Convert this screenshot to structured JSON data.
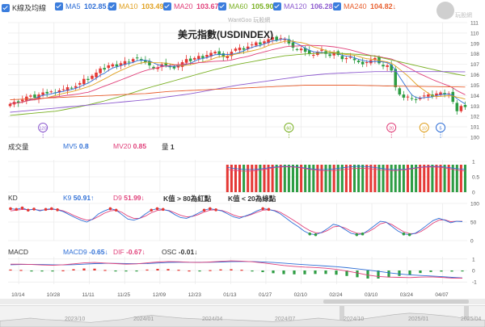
{
  "legend": {
    "items": [
      {
        "key": "k",
        "label": "K線及均線",
        "value": "",
        "color": "#333333"
      },
      {
        "key": "ma5",
        "label": "MA5",
        "value": "102.85↓",
        "color": "#2f6fd6"
      },
      {
        "key": "ma10",
        "label": "MA10",
        "value": "103.49↓",
        "color": "#e0a020"
      },
      {
        "key": "ma20",
        "label": "MA20",
        "value": "103.67↓",
        "color": "#e0407a"
      },
      {
        "key": "ma60",
        "label": "MA60",
        "value": "105.90↓",
        "color": "#7ab024"
      },
      {
        "key": "ma120",
        "label": "MA120",
        "value": "106.28↓",
        "color": "#8e5ccf"
      },
      {
        "key": "ma240",
        "label": "MA240",
        "value": "104.82↓",
        "color": "#e86030"
      }
    ]
  },
  "watermark": "WantGoo 玩股網",
  "logo_text": "玩股網",
  "title": "美元指數(USDINDEX)",
  "colors": {
    "up": "#e53935",
    "down": "#2e9d44",
    "ma5": "#2f6fd6",
    "ma10": "#e0a020",
    "ma20": "#e0407a",
    "ma60": "#7ab024",
    "ma120": "#8e5ccf",
    "ma240": "#e86030",
    "grid": "#e6e6e6"
  },
  "chart_data": [
    {
      "type": "candlestick",
      "id": "price",
      "ylim": [
        100,
        111
      ],
      "yticks": [
        100,
        101,
        102,
        103,
        104,
        105,
        106,
        107,
        108,
        109,
        110,
        111
      ],
      "x": [
        "10/14",
        "10/28",
        "11/11",
        "11/25",
        "12/09",
        "12/23",
        "01/13",
        "01/27",
        "02/10",
        "02/24",
        "03/10",
        "03/24",
        "04/07"
      ],
      "close_seq": [
        103.2,
        103.4,
        103.3,
        103.6,
        103.9,
        104.0,
        103.8,
        104.1,
        104.3,
        104.2,
        104.4,
        104.3,
        104.5,
        104.6,
        104.8,
        104.7,
        104.9,
        105.2,
        105.6,
        105.5,
        105.9,
        106.2,
        106.6,
        106.5,
        106.9,
        107.0,
        106.8,
        107.1,
        107.3,
        107.2,
        107.5,
        107.6,
        107.4,
        107.2,
        106.9,
        106.6,
        106.7,
        107.0,
        106.9,
        106.8,
        106.6,
        106.9,
        107.2,
        107.5,
        107.3,
        107.6,
        107.8,
        107.6,
        107.9,
        108.1,
        108.2,
        107.9,
        107.7,
        107.8,
        108.2,
        108.5,
        108.6,
        108.4,
        108.7,
        108.9,
        109.1,
        108.9,
        109.2,
        109.4,
        109.6,
        109.3,
        109.5,
        109.4,
        109.0,
        108.6,
        108.4,
        108.5,
        108.2,
        108.0,
        107.9,
        108.2,
        108.4,
        108.0,
        107.8,
        108.1,
        107.9,
        107.5,
        107.6,
        107.7,
        107.4,
        107.2,
        107.0,
        107.2,
        107.4,
        107.6,
        107.1,
        106.8,
        106.9,
        106.4,
        104.8,
        104.1,
        103.8,
        103.9,
        103.7,
        103.6,
        103.8,
        104.0,
        104.1,
        103.9,
        104.2,
        104.3,
        104.1,
        104.2,
        103.4,
        102.5,
        103.0,
        102.9
      ],
      "ma60_seq": [
        102.1,
        102.3,
        102.5,
        102.9,
        103.4,
        104.0,
        104.7,
        105.3,
        105.9,
        106.5,
        107.0,
        107.4,
        107.8,
        108.0,
        108.1,
        108.0,
        107.8,
        107.3,
        106.8,
        106.3,
        105.9
      ],
      "ma120_seq": [
        102.4,
        102.6,
        102.8,
        103.0,
        103.2,
        103.4,
        103.6,
        103.9,
        104.2,
        104.6,
        105.0,
        105.3,
        105.6,
        105.9,
        106.1,
        106.2,
        106.3,
        106.3,
        106.3,
        106.3,
        106.28
      ],
      "ma240_seq": [
        103.6,
        103.7,
        103.8,
        103.9,
        104.0,
        104.1,
        104.2,
        104.4,
        104.5,
        104.6,
        104.7,
        104.8,
        104.9,
        105.0,
        105.0,
        105.0,
        104.95,
        104.9,
        104.88,
        104.85,
        104.82
      ],
      "markers": [
        {
          "label": "120",
          "color": "#8e5ccf"
        },
        {
          "label": "60",
          "color": "#7ab024"
        },
        {
          "label": "20",
          "color": "#e0407a"
        },
        {
          "label": "10",
          "color": "#e0a020"
        },
        {
          "label": "5",
          "color": "#2f6fd6"
        }
      ]
    },
    {
      "type": "bar",
      "id": "volume",
      "label": "成交量",
      "mv5_label": "MV5",
      "mv5": "0.8",
      "mv20_label": "MV20",
      "mv20": "0.85",
      "vol_label": "量",
      "vol": "1",
      "ylim": [
        0,
        1
      ]
    },
    {
      "type": "line",
      "id": "kd",
      "label": "KD",
      "k_label": "K9",
      "k": "50.91↑",
      "d_label": "D9",
      "d": "51.99↓",
      "note1": "K值 > 80為紅點",
      "note2": "K值 < 20為綠點",
      "ylim": [
        0,
        100
      ],
      "k_seq": [
        86,
        84,
        88,
        82,
        85,
        80,
        84,
        86,
        83,
        78,
        70,
        62,
        55,
        50,
        58,
        72,
        80,
        86,
        82,
        70,
        58,
        55,
        60,
        72,
        82,
        86,
        84,
        80,
        70,
        62,
        60,
        66,
        74,
        82,
        86,
        83,
        80,
        72,
        64,
        60,
        66,
        72,
        80,
        86,
        84,
        80,
        72,
        60,
        48,
        38,
        26,
        18,
        16,
        22,
        32,
        44,
        40,
        30,
        20,
        16,
        18,
        28,
        40,
        52,
        50,
        38,
        26,
        18,
        16,
        20,
        30,
        42,
        54,
        60,
        55,
        48,
        52,
        51
      ],
      "d_seq": [
        80,
        82,
        84,
        83,
        84,
        82,
        83,
        84,
        84,
        80,
        74,
        66,
        60,
        55,
        57,
        65,
        74,
        80,
        82,
        76,
        66,
        60,
        60,
        66,
        75,
        81,
        83,
        81,
        75,
        68,
        64,
        65,
        70,
        77,
        82,
        83,
        81,
        76,
        69,
        64,
        65,
        70,
        76,
        82,
        83,
        81,
        76,
        67,
        57,
        47,
        36,
        27,
        21,
        21,
        27,
        37,
        39,
        34,
        26,
        20,
        19,
        24,
        33,
        45,
        49,
        43,
        33,
        24,
        19,
        19,
        25,
        35,
        47,
        55,
        56,
        51,
        52,
        52
      ]
    },
    {
      "type": "bar",
      "id": "macd",
      "label": "MACD",
      "macd_label": "MACD9",
      "macd": "-0.65↓",
      "dif_label": "DIF",
      "dif": "-0.67↓",
      "osc_label": "OSC",
      "osc": "-0.01↓",
      "ylim": [
        -1.2,
        1.2
      ],
      "dif_seq": [
        0.55,
        0.55,
        0.52,
        0.48,
        0.45,
        0.5,
        0.58,
        0.66,
        0.7,
        0.65,
        0.6,
        0.55,
        0.58,
        0.66,
        0.74,
        0.78,
        0.76,
        0.72,
        0.7,
        0.74,
        0.8,
        0.84,
        0.82,
        0.76,
        0.66,
        0.55,
        0.44,
        0.36,
        0.3,
        0.26,
        0.2,
        0.1,
        -0.05,
        -0.22,
        -0.4,
        -0.52,
        -0.58,
        -0.6,
        -0.62,
        -0.58,
        -0.56,
        -0.6,
        -0.66,
        -0.67
      ],
      "macd_seq": [
        0.5,
        0.52,
        0.53,
        0.52,
        0.5,
        0.49,
        0.51,
        0.55,
        0.6,
        0.62,
        0.62,
        0.6,
        0.59,
        0.61,
        0.65,
        0.7,
        0.72,
        0.72,
        0.72,
        0.72,
        0.74,
        0.77,
        0.78,
        0.78,
        0.75,
        0.7,
        0.64,
        0.57,
        0.51,
        0.45,
        0.39,
        0.33,
        0.25,
        0.15,
        0.04,
        -0.08,
        -0.2,
        -0.3,
        -0.38,
        -0.44,
        -0.48,
        -0.54,
        -0.6,
        -0.65
      ]
    }
  ],
  "navigator": {
    "years": [
      "2023/10",
      "2024/01",
      "2024/04",
      "2024/07",
      "2024/10",
      "2025/01",
      "2025/04"
    ]
  }
}
